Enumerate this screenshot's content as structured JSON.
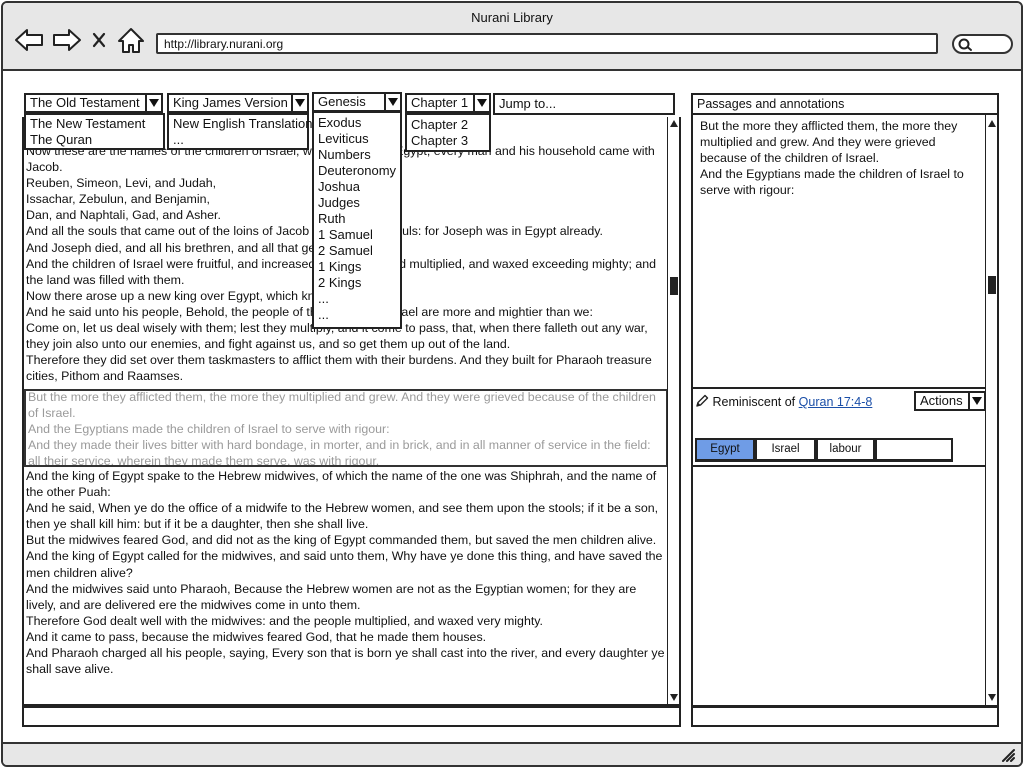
{
  "window": {
    "title": "Nurani Library",
    "url": "http://library.nurani.org"
  },
  "selectors": {
    "testament": {
      "selected": "The Old Testament",
      "options": [
        "The New Testament",
        "The Quran"
      ]
    },
    "version": {
      "selected": "King James Version",
      "options": [
        "New English Translation",
        "..."
      ]
    },
    "book": {
      "selected": "Genesis",
      "options": [
        "Exodus",
        "Leviticus",
        "Numbers",
        "Deuteronomy",
        "Joshua",
        "Judges",
        "Ruth",
        "1 Samuel",
        "2 Samuel",
        "1 Kings",
        "2 Kings",
        "...",
        "..."
      ]
    },
    "chapter": {
      "selected": "Chapter 1",
      "options": [
        "Chapter 2",
        "Chapter 3"
      ]
    },
    "jump": {
      "value": "Jump to..."
    }
  },
  "text_top": [
    "Now these are the names of the children of Israel, which came into Egypt; every man and his household came with Jacob.",
    "Reuben, Simeon, Levi, and Judah,",
    "Issachar, Zebulun, and Benjamin,",
    "Dan, and Naphtali, Gad, and Asher.",
    "And all the souls that came out of the loins of Jacob were seventy souls: for Joseph was in Egypt already.",
    "And Joseph died, and all his brethren, and all that generation.",
    "And the children of Israel were fruitful, and increased abundantly, and multiplied, and waxed exceeding mighty; and the land was filled with them.",
    "Now there arose up a new king over Egypt, which knew not Joseph.",
    "And he said unto his people, Behold, the people of the children of Israel are more and mightier than we:",
    "Come on, let us deal wisely with them; lest they multiply, and it come to pass, that, when there falleth out any war, they join also unto our enemies, and fight against us, and so get them up out of the land.",
    "Therefore they did set over them taskmasters to afflict them with their burdens. And they built for Pharaoh treasure cities, Pithom and Raamses."
  ],
  "text_highlight": [
    "But the more they afflicted them, the more they multiplied and grew. And they were grieved because of the children of Israel.",
    "And the Egyptians made the children of Israel to serve with rigour:",
    "And they made their lives bitter with hard bondage, in morter, and in brick, and in all manner of service in the field: all their service, wherein they made them serve, was with rigour."
  ],
  "text_bottom": [
    "And the king of Egypt spake to the Hebrew midwives, of which the name of the one was Shiphrah, and the name of the other Puah:",
    "And he said, When ye do the office of a midwife to the Hebrew women, and see them upon the stools; if it be a son, then ye shall kill him: but if it be a daughter, then she shall live.",
    "But the midwives feared God, and did not as the king of Egypt commanded them, but saved the men children alive.",
    "And the king of Egypt called for the midwives, and said unto them, Why have ye done this thing, and have saved the men children alive?",
    "And the midwives said unto Pharaoh, Because the Hebrew women are not as the Egyptian women; for they are lively, and are delivered ere the midwives come in unto them.",
    "Therefore God dealt well with the midwives: and the people multiplied, and waxed very mighty.",
    "And it came to pass, because the midwives feared God, that he made them houses.",
    "And Pharaoh charged all his people, saying, Every son that is born ye shall cast into the river, and every daughter ye shall save alive."
  ],
  "annotations": {
    "header": "Passages and annotations",
    "passage": [
      "But the more they afflicted them, the more they multiplied and grew. And they were grieved because of the children of Israel.",
      "And the Egyptians made the children of Israel to serve with rigour:"
    ],
    "reminiscent_label": "Reminiscent of",
    "reminiscent_link": "Quran 17:4-8",
    "actions_label": "Actions",
    "tags": [
      "Egypt",
      "Israel",
      "labour"
    ],
    "active_tag": "Egypt"
  }
}
